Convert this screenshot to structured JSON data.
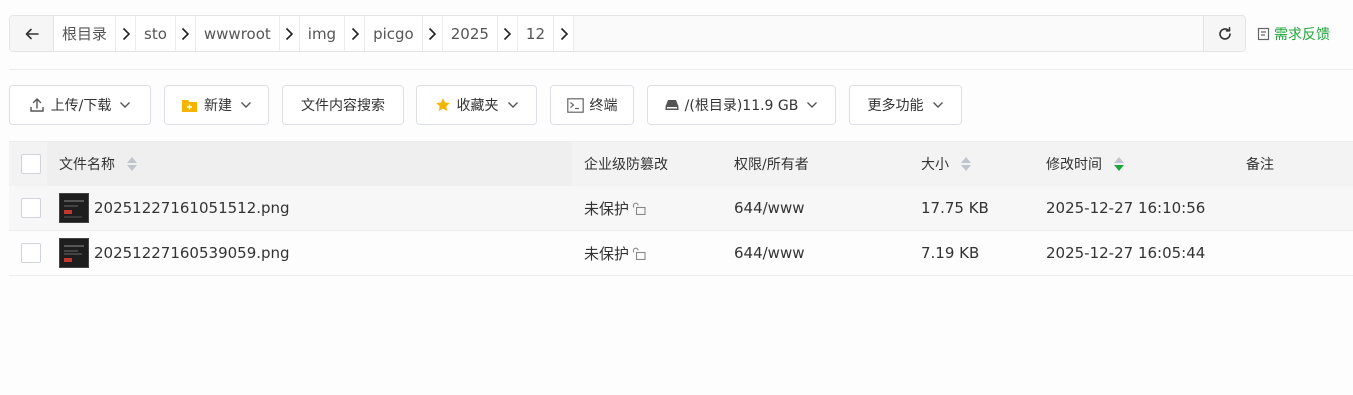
{
  "breadcrumb": {
    "items": [
      "根目录",
      "sto",
      "wwwroot",
      "img",
      "picgo",
      "2025",
      "12"
    ]
  },
  "feedback": {
    "label": "需求反馈"
  },
  "toolbar": {
    "upload_label": "上传/下载",
    "new_label": "新建",
    "search_label": "文件内容搜索",
    "favorites_label": "收藏夹",
    "terminal_label": "终端",
    "disk_label": "/(根目录)11.9 GB",
    "more_label": "更多功能"
  },
  "table": {
    "headers": {
      "name": "文件名称",
      "tamper": "企业级防篡改",
      "perm": "权限/所有者",
      "size": "大小",
      "mtime": "修改时间",
      "note": "备注"
    },
    "rows": [
      {
        "name": "20251227161051512.png",
        "tamper": "未保护",
        "perm": "644/www",
        "size": "17.75 KB",
        "mtime": "2025-12-27 16:10:56",
        "note": ""
      },
      {
        "name": "20251227160539059.png",
        "tamper": "未保护",
        "perm": "644/www",
        "size": "7.19 KB",
        "mtime": "2025-12-27 16:05:44",
        "note": ""
      }
    ]
  },
  "colors": {
    "accent": "#20a53a",
    "gold": "#f5b400"
  }
}
